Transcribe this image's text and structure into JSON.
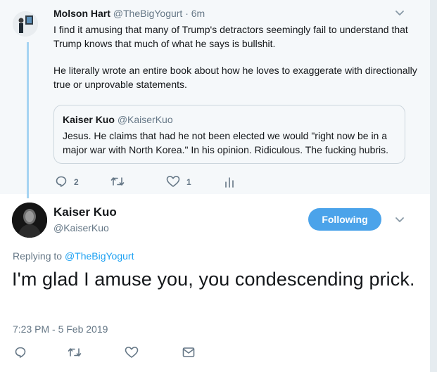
{
  "parent_tweet": {
    "author_name": "Molson Hart",
    "author_handle": "@TheBigYogurt",
    "time": "· 6m",
    "paragraphs": [
      "I find it amusing that many of Trump's detractors seemingly fail to understand that Trump knows that much of what he says is bullshit.",
      "He literally wrote an entire book about how he loves to exaggerate with directionally true or unprovable statements."
    ],
    "quote": {
      "author_name": "Kaiser Kuo",
      "author_handle": "@KaiserKuo",
      "text": "Jesus. He claims that had he not been elected we would \"right now be in a major war with North Korea.\" In his opinion. Ridiculous. The fucking hubris."
    },
    "actions": {
      "reply_count": "2",
      "retweet_count": "",
      "like_count": "1"
    }
  },
  "main_tweet": {
    "author_name": "Kaiser Kuo",
    "author_handle": "@KaiserKuo",
    "follow_label": "Following",
    "replying_prefix": "Replying to",
    "replying_handle": "@TheBigYogurt",
    "text": "I'm glad I amuse you, you condescending prick.",
    "timestamp": "7:23 PM - 5 Feb 2019"
  },
  "colors": {
    "accent": "#1da1f2",
    "follow_button": "#4ba3ea",
    "muted_text": "#657786",
    "thread_line": "#a6d4f2",
    "parent_bg": "#f5f8fa"
  },
  "icons": [
    "chevron-down-icon",
    "reply-icon",
    "retweet-icon",
    "like-icon",
    "analytics-icon",
    "direct-message-icon"
  ]
}
